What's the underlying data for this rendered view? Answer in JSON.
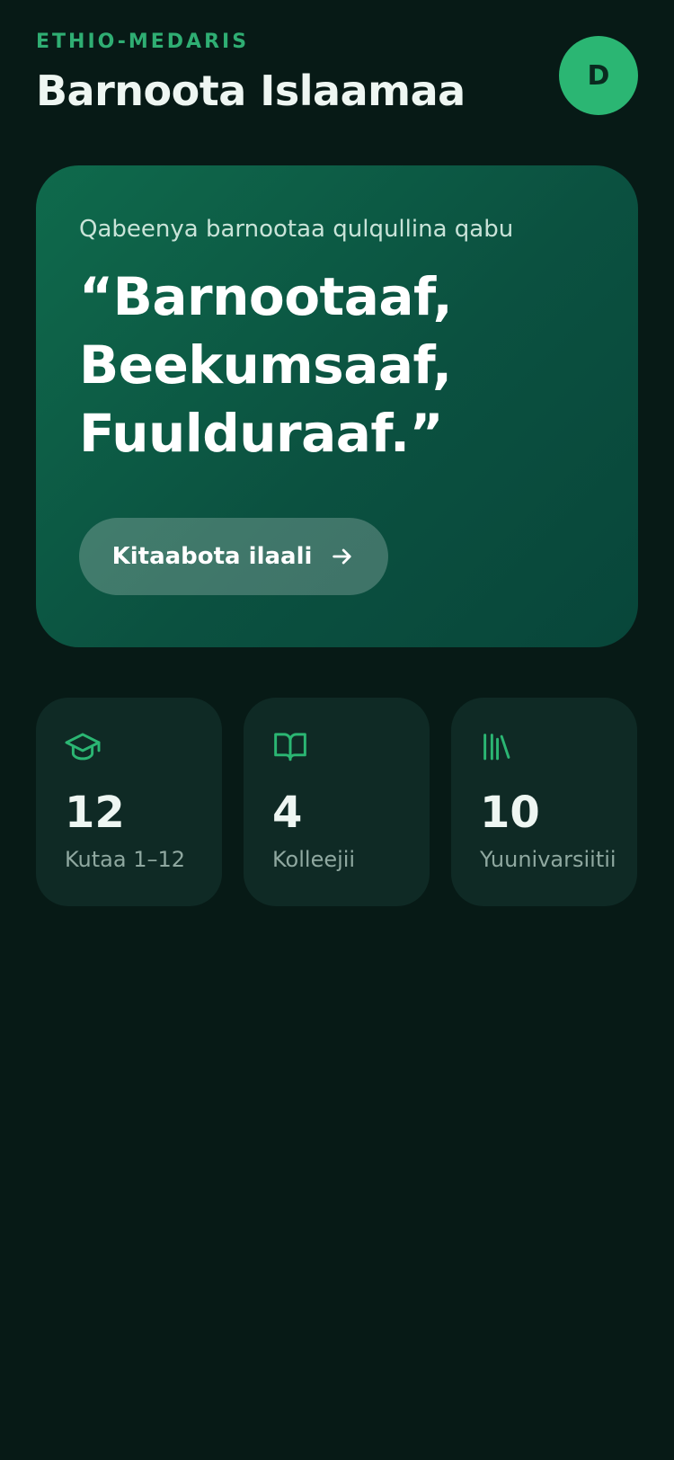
{
  "header": {
    "brand": "ETHIO-MEDARIS",
    "title": "Barnoota Islaamaa",
    "avatar_initial": "D"
  },
  "hero": {
    "subtitle": "Qabeenya barnootaa qulqullina qabu",
    "quote_lines": [
      "“Barnootaaf,",
      "Beekumsaaf,",
      "Fuulduraaf.”"
    ],
    "button_label": "Kitaabota ilaali",
    "button_icon": "arrow-right-icon"
  },
  "stats": [
    {
      "icon": "graduation-cap-icon",
      "value": "12",
      "label": "Kutaa 1–12"
    },
    {
      "icon": "open-book-icon",
      "value": "4",
      "label": "Kolleejii"
    },
    {
      "icon": "library-icon",
      "value": "10",
      "label": "Yuunivarsiitii"
    }
  ],
  "colors": {
    "background": "#071a16",
    "accent": "#2bb673",
    "card": "#0f2a25",
    "hero_start": "#0f6a4c",
    "hero_end": "#08463a"
  }
}
